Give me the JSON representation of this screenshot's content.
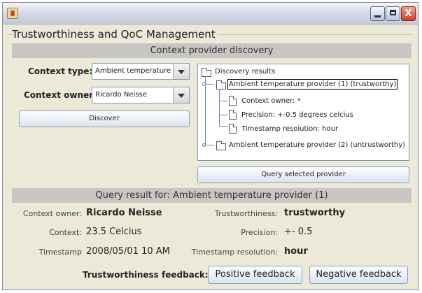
{
  "window": {
    "title": "",
    "controls": {
      "minimize": "minimize",
      "maximize": "maximize",
      "close": "X"
    }
  },
  "group_title": "Trustworthiness and QoC Management",
  "discovery": {
    "header": "Context provider discovery",
    "context_type_label": "Context type:",
    "context_type_value": "Ambient temperature",
    "context_owner_label": "Context owner:",
    "context_owner_value": "Ricardo Neisse",
    "discover_button": "Discover",
    "tree": {
      "root": "Discovery results",
      "provider1": "Ambient temperature provider (1) (trustworthy)",
      "provider1_children": [
        "Context owner: *",
        "Precision: +-0.5 degrees celcius",
        "Timestamp resolution: hour"
      ],
      "provider2": "Ambient temperature provider (2) (untrustworthy)"
    },
    "query_button": "Query selected provider"
  },
  "result": {
    "header": "Query result for: Ambient temperature provider (1)",
    "context_owner_label": "Context owner:",
    "context_owner_value": "Ricardo Neisse",
    "context_label": "Context:",
    "context_value": "23.5 Celcius",
    "timestamp_label": "Timestamp",
    "timestamp_value": "2008/05/01 10 AM",
    "trust_label": "Trustworthiness:",
    "trust_value": "trustworthy",
    "precision_label": "Precision:",
    "precision_value": "+- 0.5",
    "ts_res_label": "Timestamp resolution:",
    "ts_res_value": "hour",
    "feedback_label": "Trustworthiness feedback:",
    "positive_button": "Positive feedback",
    "negative_button": "Negative feedback"
  }
}
